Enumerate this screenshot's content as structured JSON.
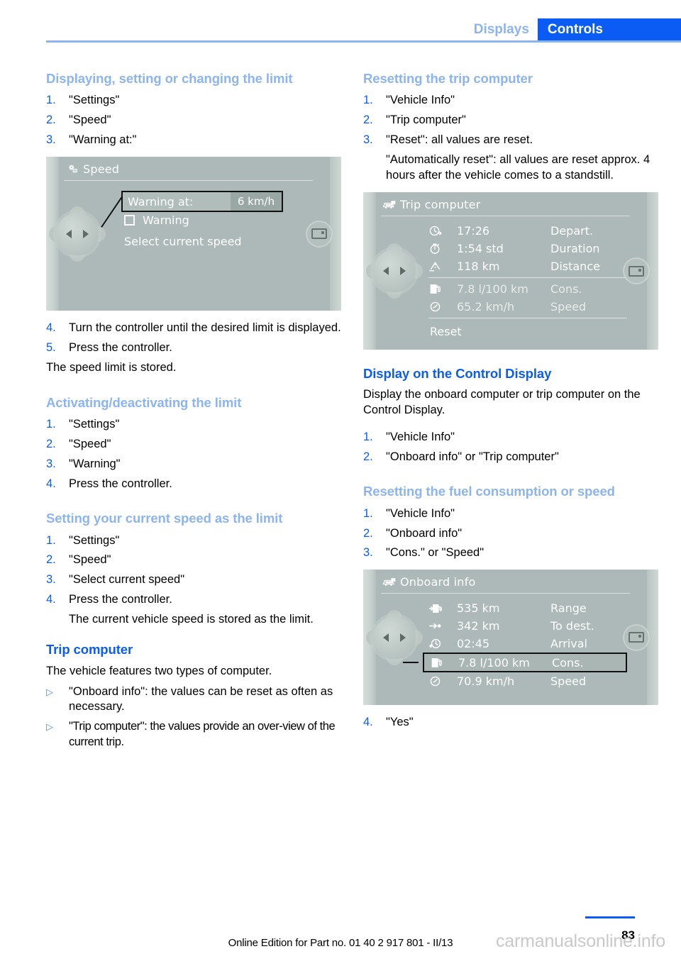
{
  "header": {
    "tab_inactive": "Displays",
    "tab_active": "Controls",
    "accent_blue": "#0a5cf5",
    "light_blue": "#8cb4f0"
  },
  "left_column": {
    "section1": {
      "heading": "Displaying, setting or changing the limit",
      "steps": [
        {
          "num": "1.",
          "text": "\"Settings\""
        },
        {
          "num": "2.",
          "text": "\"Speed\""
        },
        {
          "num": "3.",
          "text": "\"Warning at:\""
        }
      ],
      "steps_after": [
        {
          "num": "4.",
          "text": "Turn the controller until the desired limit is displayed."
        },
        {
          "num": "5.",
          "text": "Press the controller."
        }
      ],
      "closing": "The speed limit is stored."
    },
    "figure_speed": {
      "title": "Speed",
      "title_icon": "settings-gear-icon",
      "warning_label": "Warning at:",
      "warning_value": "6 km/h",
      "checkbox_label": "Warning",
      "option_label": "Select current speed"
    },
    "section2": {
      "heading": "Activating/deactivating the limit",
      "steps": [
        {
          "num": "1.",
          "text": "\"Settings\""
        },
        {
          "num": "2.",
          "text": "\"Speed\""
        },
        {
          "num": "3.",
          "text": "\"Warning\""
        },
        {
          "num": "4.",
          "text": "Press the controller."
        }
      ]
    },
    "section3": {
      "heading": "Setting your current speed as the limit",
      "steps": [
        {
          "num": "1.",
          "text": "\"Settings\""
        },
        {
          "num": "2.",
          "text": "\"Speed\""
        },
        {
          "num": "3.",
          "text": "\"Select current speed\""
        },
        {
          "num": "4.",
          "text": "Press the controller."
        }
      ],
      "continuation": "The current vehicle speed is stored as the limit."
    },
    "section4": {
      "heading": "Trip computer",
      "intro": "The vehicle features two types of computer.",
      "bullets": [
        {
          "marker": "▷",
          "text": "\"Onboard info\": the values can be reset as often as necessary."
        },
        {
          "marker": "▷",
          "text": "\"Trip computer\": the values provide an over-view of the current trip."
        }
      ]
    }
  },
  "right_column": {
    "section1": {
      "heading": "Resetting the trip computer",
      "steps": [
        {
          "num": "1.",
          "text": "\"Vehicle Info\""
        },
        {
          "num": "2.",
          "text": "\"Trip computer\""
        },
        {
          "num": "3.",
          "text": "\"Reset\": all values are reset."
        }
      ],
      "continuation": "\"Automatically reset\": all values are reset approx. 4 hours after the vehicle comes to a standstill."
    },
    "figure_trip": {
      "title": "Trip computer",
      "title_icon": "vehicle-display-icon",
      "rows": [
        {
          "icon": "clock-depart-icon",
          "value": "17:26",
          "name": "Depart."
        },
        {
          "icon": "stopwatch-icon",
          "value": "1:54 std",
          "name": "Duration"
        },
        {
          "icon": "distance-road-icon",
          "value": "118 km",
          "name": "Distance"
        },
        {
          "icon": "fuel-pump-icon",
          "value": "7.8 l/100 km",
          "name": "Cons."
        },
        {
          "icon": "speedometer-icon",
          "value": "65.2 km/h",
          "name": "Speed"
        }
      ],
      "reset_label": "Reset"
    },
    "section2": {
      "heading": "Display on the Control Display",
      "intro": "Display the onboard computer or trip computer on the Control Display.",
      "steps": [
        {
          "num": "1.",
          "text": "\"Vehicle Info\""
        },
        {
          "num": "2.",
          "text": "\"Onboard info\" or \"Trip computer\""
        }
      ]
    },
    "section3": {
      "heading": "Resetting the fuel consumption or speed",
      "steps": [
        {
          "num": "1.",
          "text": "\"Vehicle Info\""
        },
        {
          "num": "2.",
          "text": "\"Onboard info\""
        },
        {
          "num": "3.",
          "text": "\"Cons.\" or \"Speed\""
        }
      ],
      "final_step": {
        "num": "4.",
        "text": "\"Yes\""
      }
    },
    "figure_onboard": {
      "title": "Onboard info",
      "title_icon": "vehicle-display-icon",
      "rows": [
        {
          "icon": "fuel-range-icon",
          "value": "535 km",
          "name": "Range",
          "highlighted": false
        },
        {
          "icon": "to-destination-icon",
          "value": "342 km",
          "name": "To dest.",
          "highlighted": false
        },
        {
          "icon": "arrival-clock-icon",
          "value": "02:45",
          "name": "Arrival",
          "highlighted": false
        },
        {
          "icon": "fuel-pump-icon",
          "value": "7.8 l/100 km",
          "name": "Cons.",
          "highlighted": true
        },
        {
          "icon": "speedometer-icon",
          "value": "70.9 km/h",
          "name": "Speed",
          "highlighted": false
        }
      ]
    }
  },
  "footer": {
    "online_edition": "Online Edition for Part no. 01 40 2 917 801 - II/13",
    "page_number": "83",
    "watermark": "carmanualsonline.info"
  }
}
